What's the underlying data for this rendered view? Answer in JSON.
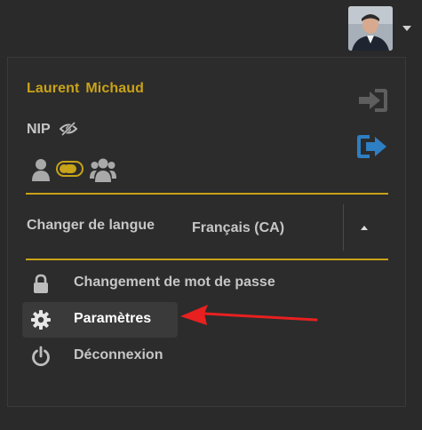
{
  "user": {
    "first_name": "Laurent",
    "last_name": "Michaud"
  },
  "nip_label": "NIP",
  "language": {
    "label": "Changer de langue",
    "selected": "Français (CA)"
  },
  "menu": [
    {
      "label": "Changement de mot de passe",
      "icon": "lock-icon"
    },
    {
      "label": "Paramètres",
      "icon": "gear-icon"
    },
    {
      "label": "Déconnexion",
      "icon": "power-icon"
    }
  ],
  "colors": {
    "accent": "#c9a318",
    "logout": "#2e7fc4",
    "arrow": "#e8201f"
  }
}
